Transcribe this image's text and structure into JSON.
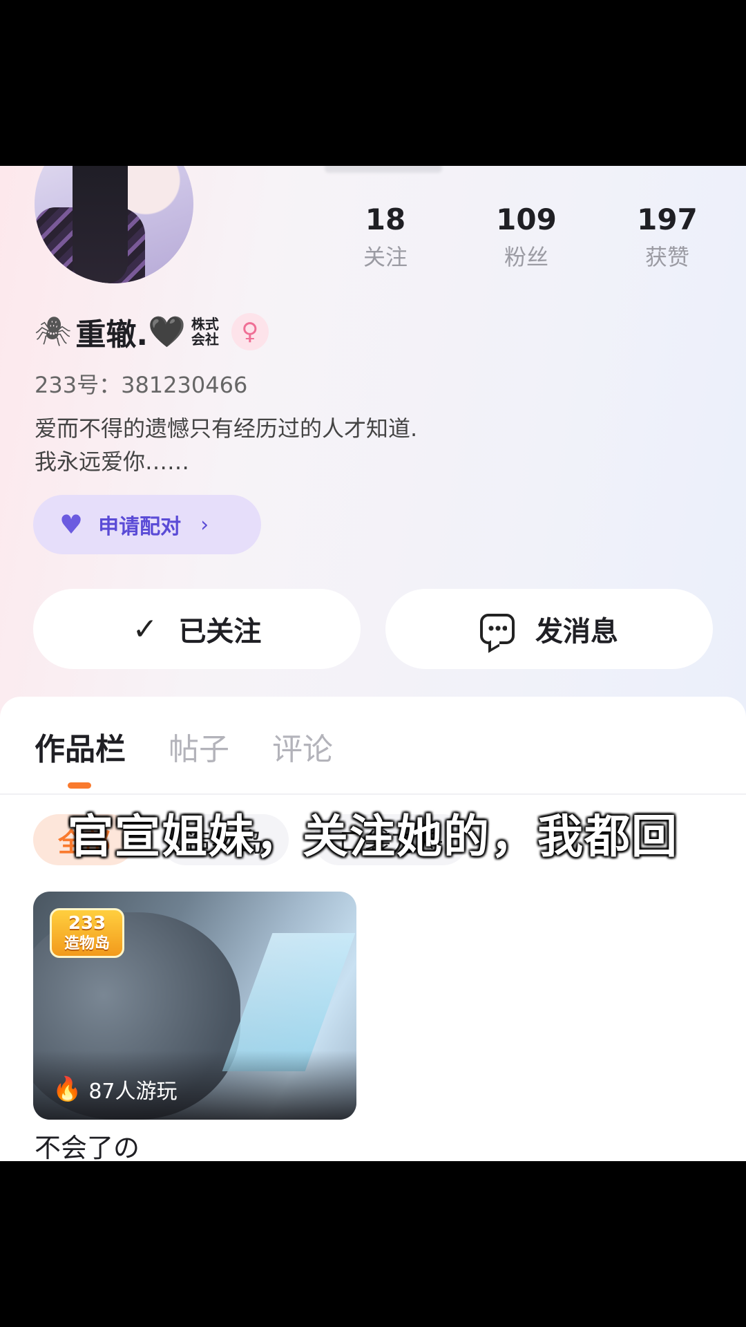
{
  "profile": {
    "name": "重辙.",
    "name_heart": "🖤",
    "company_tag_line1": "株式",
    "company_tag_line2": "会社",
    "gender_symbol": "♀",
    "uid": "233号：381230466",
    "bio_line1": "爱而不得的遗憾只有经历过的人才知道.",
    "bio_line2": "我永远爱你……"
  },
  "stats": [
    {
      "value": "18",
      "label": "关注"
    },
    {
      "value": "109",
      "label": "粉丝"
    },
    {
      "value": "197",
      "label": "获赞"
    }
  ],
  "pair_button": {
    "label": "申请配对",
    "chevron": "›"
  },
  "actions": {
    "follow_label": "已关注",
    "follow_icon": "✓",
    "message_label": "发消息"
  },
  "tabs": [
    {
      "label": "作品栏",
      "active": true
    },
    {
      "label": "帖子",
      "active": false
    },
    {
      "label": "评论",
      "active": false
    }
  ],
  "chips": [
    {
      "label": "全部",
      "active": true
    },
    {
      "label": "造物岛",
      "active": false
    },
    {
      "label": "口袋方舟",
      "active": false
    }
  ],
  "card": {
    "logo_line1": "233",
    "logo_line2": "造物岛",
    "plays": "87人游玩",
    "title": "不会了の"
  },
  "video_subtitle": "官宣姐妹，关注她的，我都回",
  "colors": {
    "accent_orange": "#f97a2e",
    "pair_purple": "#5a4bd6",
    "gender_pink": "#ef6f95"
  },
  "icons": [
    "spider-icon",
    "gender-female-icon",
    "heart-icon",
    "check-icon",
    "message-icon",
    "flame-icon"
  ]
}
